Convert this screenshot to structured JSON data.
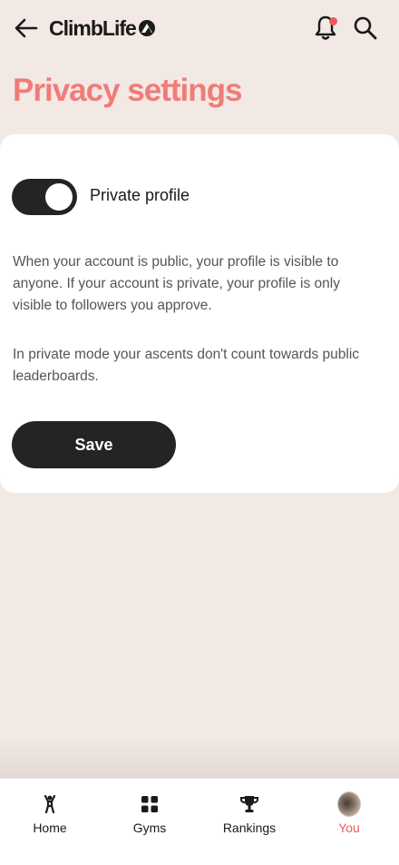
{
  "header": {
    "logo_text": "ClimbLife",
    "has_notification": true
  },
  "page": {
    "title": "Privacy settings"
  },
  "privacy": {
    "toggle_label": "Private profile",
    "toggle_on": true,
    "description_1": "When your account is public, your profile is visible to anyone. If your account is private, your profile is only visible to followers you approve.",
    "description_2": "In private mode your ascents don't count towards public leaderboards.",
    "save_label": "Save"
  },
  "nav": {
    "items": [
      {
        "label": "Home",
        "icon": "climber-icon",
        "active": false
      },
      {
        "label": "Gyms",
        "icon": "grid-icon",
        "active": false
      },
      {
        "label": "Rankings",
        "icon": "trophy-icon",
        "active": false
      },
      {
        "label": "You",
        "icon": "avatar",
        "active": true
      }
    ]
  },
  "colors": {
    "background": "#f2e8e4",
    "accent": "#f07c78",
    "active_nav": "#ec5a5f",
    "dark": "#222426",
    "notification_dot": "#ec5a5f"
  }
}
